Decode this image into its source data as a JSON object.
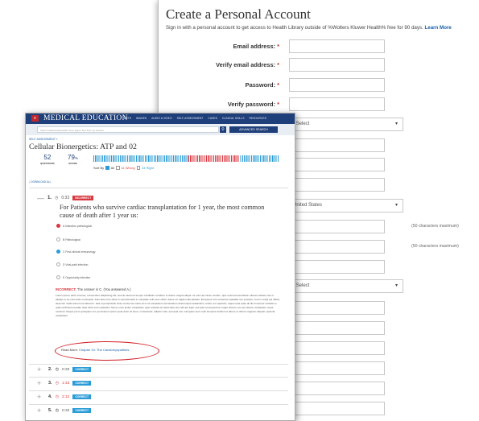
{
  "account": {
    "title": "Create a Personal Account",
    "subtitle": "Sign in with a personal account to get access to Health Library outside of %Wolters Kluwer Health% free for 90 days.",
    "learn_more": "Learn More",
    "email_label": "Email address:",
    "verify_email_label": "Verify email address:",
    "password_label": "Password:",
    "verify_password_label": "Verify password:",
    "required_mark": "*",
    "select_placeholder": "- Select",
    "country_value": "United States",
    "char_note_1": "(50 characters maximum)",
    "char_note_2": "(50 characters maximum)",
    "caret": "▾"
  },
  "medical": {
    "brand": "MEDICAL EDUCATION",
    "menu_icon": "≡",
    "nav": [
      "TEXTS",
      "IMAGES",
      "AUDIO & VIDEO",
      "SELF-ASSESSMENT",
      "CASES",
      "CLINICAL SKILLS",
      "RESOURCES"
    ],
    "search_placeholder": "Search Medical Education Free Hyper Text Full / by Section",
    "search_icon": "⚲",
    "advanced_search": "ADVANCED SEARCH",
    "breadcrumb": "SELF-ASSESSMENT »",
    "page_title": "Cellular Bionergetics: ATP and 02",
    "questions_count": "52",
    "questions_label": "QUESTIONS",
    "score_value": "79",
    "score_pct": "%",
    "score_label": "SCORE",
    "progress_correct_fraction": 0.79,
    "sort_by": "Sort By",
    "filter_all": "All",
    "filter_wrong": "11 Wrong",
    "filter_right": "24 Right",
    "download_all": "⤓ DOWNLOAD ALL",
    "q1": {
      "number": "1.",
      "time": "0:33",
      "status": "INCORRECT",
      "text": "For Patients who survive cardiac transplantation for 1 year, the most common cause of death after 1 year us:",
      "options": [
        "A  Infarction pathological",
        "B  Pathological",
        "C  First-clinical immunology",
        "D  Viral-path infection",
        "E  Opportunity infection"
      ],
      "explanation_label": "INCORRECT:",
      "explanation_answer": "The answer is C.",
      "explanation_you": "(You answered A.)",
      "explanation_body": "Lorem ipsum dolor sit amet, consectetur adipisicing elit, sed do eiusmod tempor incididunt ut labore et dolore magna aliqua. Ut enim ad minim veniam, quis nostrud exercitation ullamco laboris nisi ut aliquip ex ea commodo consequat. Duis aute irure dolor in reprehenderit in voluptate velit esse cillum dolore eu fugiat nulla pariatur. Excepteur sint occaecat cupidatat non proident, sunt in culpa qui officia deserunt mollit anim id est laborum. Sed ut perspiciatis unde omnis iste natus error sit voluptatem accusantium doloremque laudantium, totam rem aperiam, eaque ipsa quae ab illo inventore veritatis et quasi architecto beatae vitae dicta sunt explicabo. Nemo enim ipsam voluptatem quia voluptas sit aspernatur aut odit aut fugit, sed quia consequuntur magni dolores eos qui ratione voluptatem sequi nesciunt. Neque porro quisquam est, qui dolorem ipsum quia dolor sit amet, consectetur, adipisci velit, sed quia non numquam eius modi tempora incidunt ut labore et dolore magnam aliquam quaerat voluptatem.",
      "read_more_prefix": "Read More:",
      "read_more_link": "Chapter 10: The Cardiomyopathies"
    },
    "clock_icon": "◷",
    "collapse_icon": "—",
    "expand_icon": "+",
    "rows": [
      {
        "number": "2.",
        "time": "0:33",
        "status": "CORRECT"
      },
      {
        "number": "3.",
        "time": "1:43",
        "status": "CORRECT"
      },
      {
        "number": "4.",
        "time": "2:12",
        "status": "CORRECT"
      },
      {
        "number": "5.",
        "time": "0:32",
        "status": "CORRECT"
      }
    ]
  }
}
